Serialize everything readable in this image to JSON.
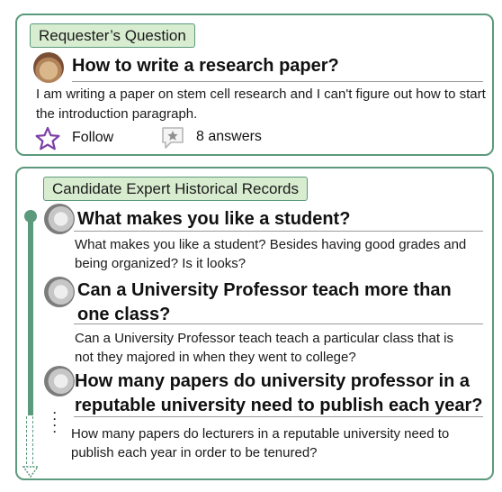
{
  "requester": {
    "tag": "Requester’s Question",
    "question_title": "How to write a research paper?",
    "question_body": "I am writing a paper on stem cell research and I can't figure out how to start the introduction paragraph.",
    "follow_label": "Follow",
    "answers_label": "8 answers",
    "follow_icon": "star-outline-icon",
    "answers_icon": "speech-bubble-star-icon"
  },
  "candidate": {
    "tag": "Candidate Expert Historical Records",
    "records": [
      {
        "title": "What makes you like a student?",
        "body": "What makes you like a student? Besides having good grades and being organized? Is it looks?"
      },
      {
        "title": "Can a University Professor teach more than one class?",
        "body": "Can a University Professor teach teach a particular class that is not they majored in when they went to college?"
      },
      {
        "title": "How many papers do university professor in a reputable university need to publish each year?",
        "body": "How many papers do lecturers in a reputable university need to publish each year in order to be tenured?"
      }
    ]
  },
  "colors": {
    "border_green": "#5b9a7c",
    "tag_fill": "#d8ecd0",
    "star_purple": "#7b3fa6"
  }
}
